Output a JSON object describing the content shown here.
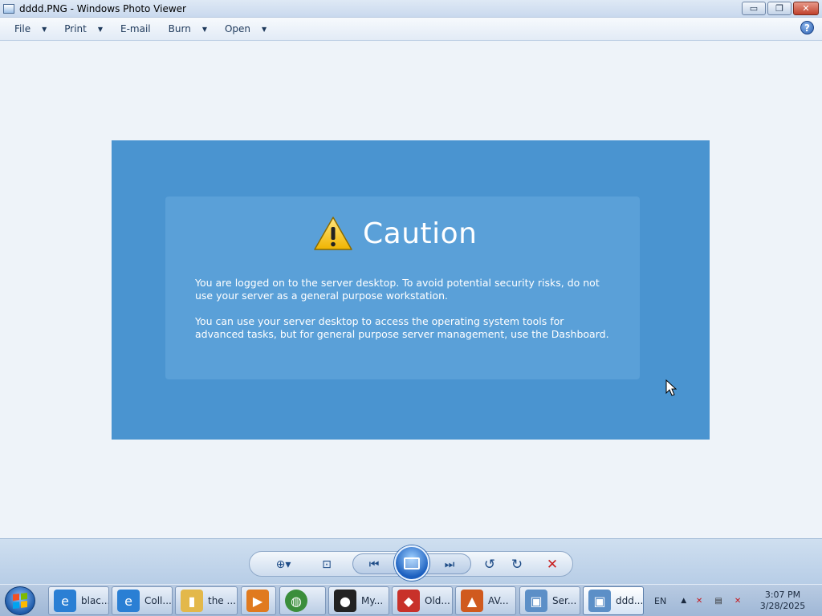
{
  "window": {
    "title": "dddd.PNG - Windows Photo Viewer",
    "minimize_glyph": "▭",
    "restore_glyph": "❐",
    "close_glyph": "✕"
  },
  "menu": {
    "items": [
      {
        "label": "File"
      },
      {
        "label": "Print"
      },
      {
        "label": "E-mail"
      },
      {
        "label": "Burn"
      },
      {
        "label": "Open"
      }
    ],
    "help_glyph": "?"
  },
  "photo": {
    "heading": "Caution",
    "paragraph1": "You are logged on to the server desktop. To avoid potential security risks, do not use your server as a general purpose workstation.",
    "paragraph2": "You can use your server desktop to access the operating system tools for advanced tasks, but for general purpose server management, use the Dashboard.",
    "background_color": "#4a94d0",
    "box_color": "#5aa0d8"
  },
  "toolbar": {
    "buttons": [
      {
        "name": "zoom-button",
        "icon": "zoom-icon",
        "glyph": "⊕▾"
      },
      {
        "name": "actual-size-button",
        "icon": "fit-window-icon",
        "glyph": "⊡"
      },
      {
        "name": "previous-button",
        "icon": "previous-icon",
        "glyph": "⏮"
      },
      {
        "name": "slideshow-button",
        "icon": "slideshow-icon",
        "glyph": ""
      },
      {
        "name": "next-button",
        "icon": "next-icon",
        "glyph": "⏭"
      },
      {
        "name": "rotate-left-button",
        "icon": "rotate-counterclockwise-icon",
        "glyph": "↺"
      },
      {
        "name": "rotate-right-button",
        "icon": "rotate-clockwise-icon",
        "glyph": "↻"
      },
      {
        "name": "delete-button",
        "icon": "delete-icon",
        "glyph": "✕"
      }
    ]
  },
  "taskbar": {
    "tasks": [
      {
        "label": "blac...",
        "icon": "internet-explorer-icon",
        "color": "#2a7fd4"
      },
      {
        "label": "Coll...",
        "icon": "internet-explorer-icon",
        "color": "#2a7fd4"
      },
      {
        "label": "the ...",
        "icon": "folder-icon",
        "color": "#e3b84a"
      },
      {
        "label": "",
        "icon": "media-player-icon",
        "color": "#e07a1f"
      },
      {
        "label": "",
        "icon": "globe-icon",
        "color": "#3b8e3b"
      },
      {
        "label": "My...",
        "icon": "cat-avatar-icon",
        "color": "#222222"
      },
      {
        "label": "Old...",
        "icon": "red-diamond-icon",
        "color": "#c8312a"
      },
      {
        "label": "AV...",
        "icon": "avg-icon",
        "color": "#d05a1e"
      },
      {
        "label": "Ser...",
        "icon": "photo-viewer-icon",
        "color": "#5c8fc7"
      },
      {
        "label": "ddd...",
        "icon": "photo-viewer-icon",
        "color": "#5c8fc7"
      }
    ],
    "tray": {
      "language": "EN",
      "show_hidden_glyph": "▲",
      "time": "3:07 PM",
      "date": "3/28/2025"
    }
  }
}
